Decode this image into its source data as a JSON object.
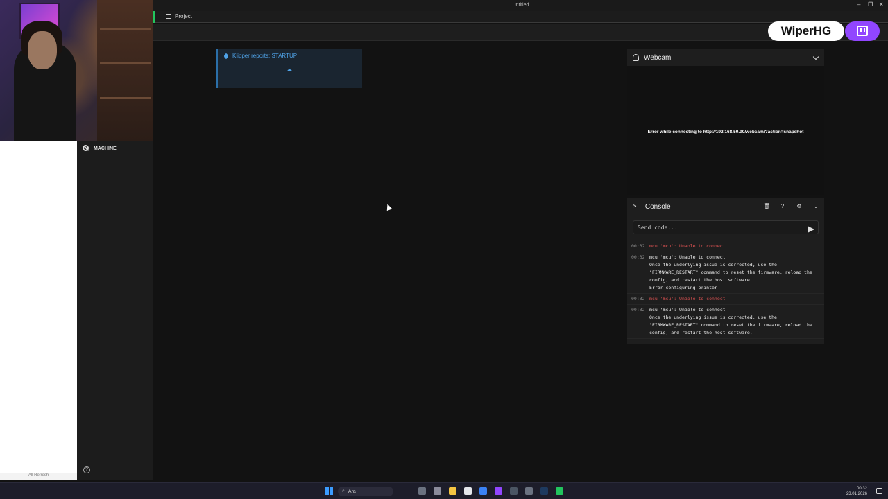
{
  "window": {
    "title": "Untitled",
    "tab": "Project"
  },
  "branding": {
    "channel": "WiperHG"
  },
  "stream_panel": {
    "refresh_label": "All Refresh"
  },
  "sidebar": {
    "machine_label": "MACHINE"
  },
  "notification": {
    "title": "Klipper reports: STARTUP"
  },
  "webcam": {
    "title": "Webcam",
    "error": "Error while connecting to http://192.168.50.90/webcam/?action=snapshot"
  },
  "console": {
    "title": "Console",
    "input_placeholder": "Send code...",
    "entries": [
      {
        "time": "00:32",
        "msg": "mcu 'mcu': Unable to connect"
      },
      {
        "time": "00:32",
        "msg": "mcu 'mcu': Unable to connect\nOnce the underlying issue is corrected, use the\n\"FIRMWARE_RESTART\" command to reset the firmware, reload the\nconfig, and restart the host software.\nError configuring printer"
      },
      {
        "time": "00:32",
        "msg": "mcu 'mcu': Unable to connect"
      },
      {
        "time": "00:32",
        "msg": "mcu 'mcu': Unable to connect\nOnce the underlying issue is corrected, use the\n\"FIRMWARE_RESTART\" command to reset the firmware, reload the\nconfig, and restart the host software."
      }
    ]
  },
  "taskbar": {
    "search_label": "Ara",
    "time": "00:32",
    "date": "23.01.2026"
  },
  "colors": {
    "accent_blue": "#4fa3e8",
    "error_red": "#e05353",
    "twitch": "#9146ff",
    "tab_accent": "#22c55e"
  }
}
